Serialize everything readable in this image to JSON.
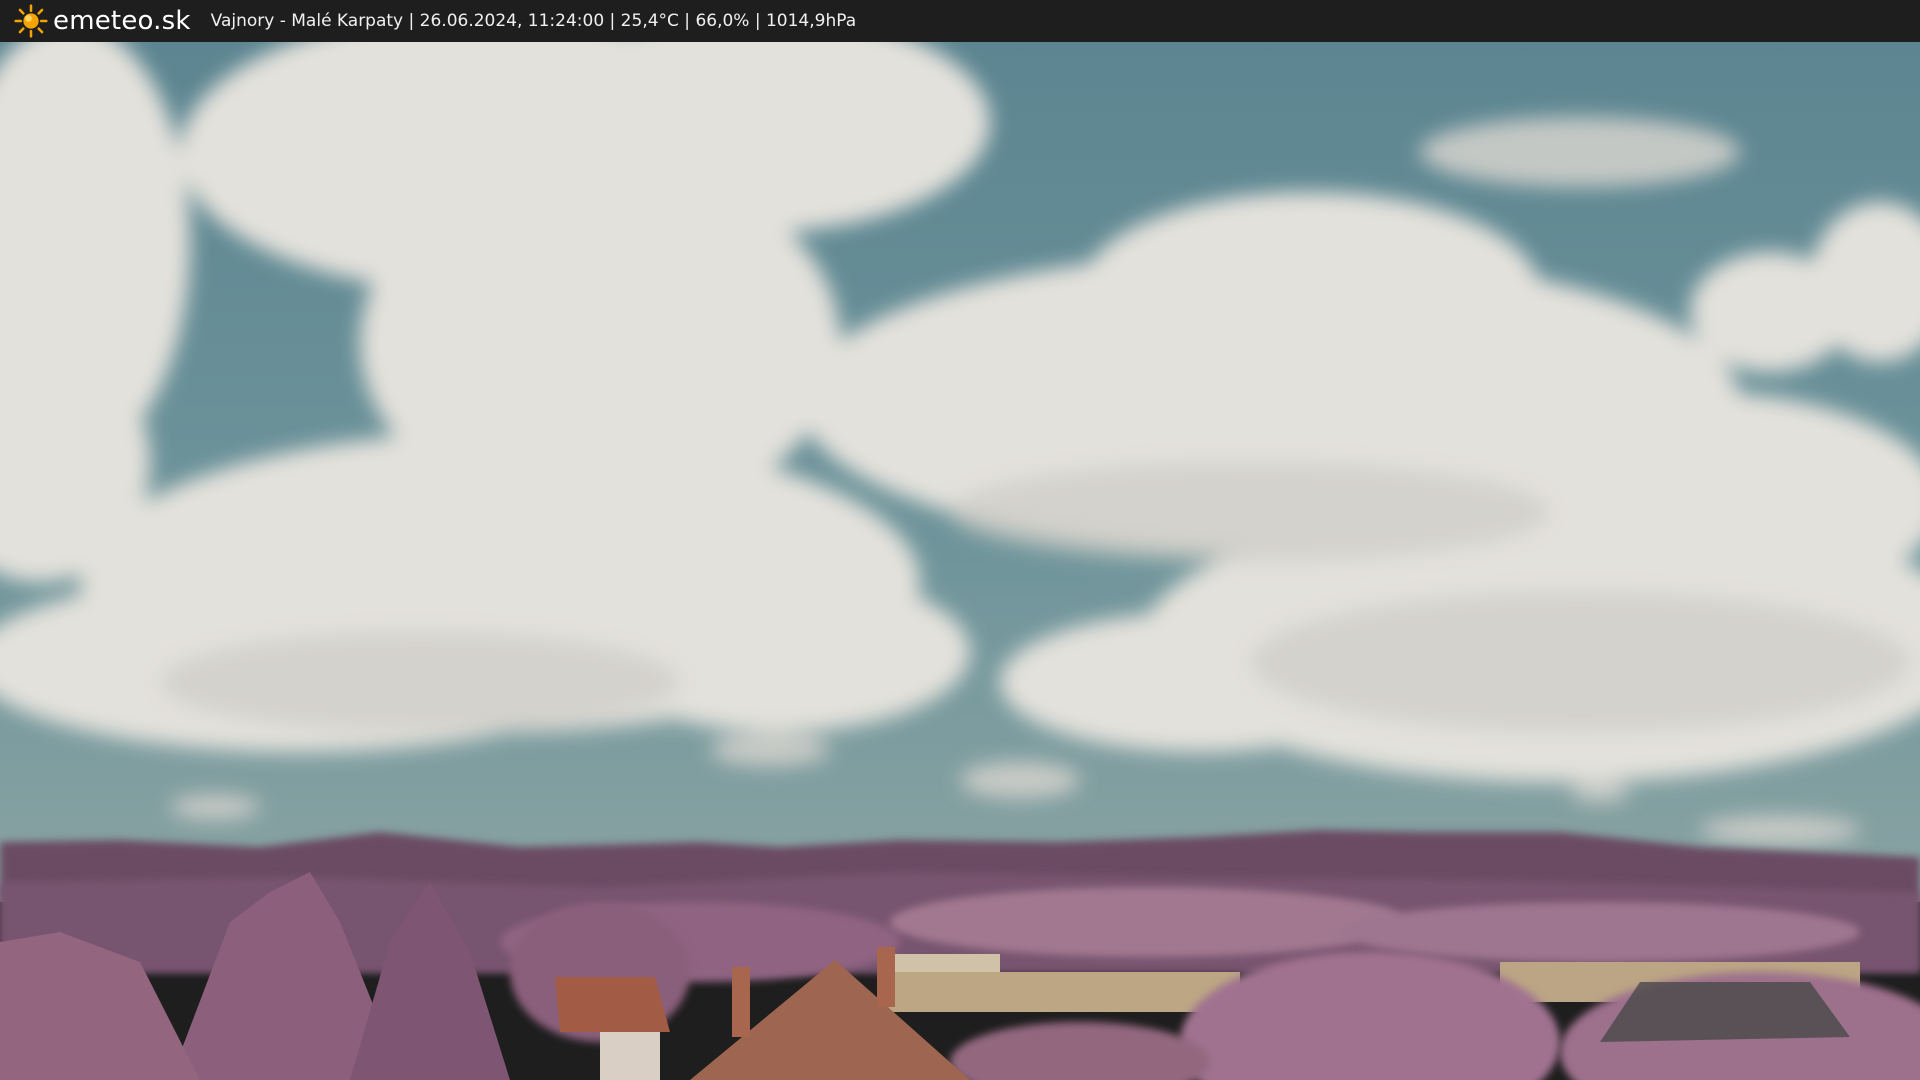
{
  "brand": {
    "name": "emeteo.sk",
    "logo_icon": "sun-icon",
    "logo_color": "#f5a300"
  },
  "camera": {
    "caption": "Vajnory - Malé Karpaty | 26.06.2024, 11:24:00 | 25,4°C | 66,0% | 1014,9hPa"
  },
  "colors": {
    "bar": "#1e1e1e",
    "sky": "#5f8790",
    "cloud": "#e6e4de",
    "hills": "#6a4a62",
    "trees": "#9a6a86",
    "roof": "#a5684e"
  }
}
